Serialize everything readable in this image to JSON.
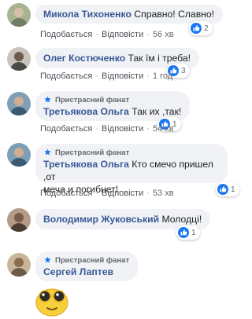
{
  "fan_badge": "Пристрасний фанат",
  "actions": {
    "like": "Подобається",
    "reply": "Відповісти"
  },
  "comments": [
    {
      "author": "Микола Тихоненко",
      "text": "Справно! Славно!",
      "time": "56 хв",
      "reactions": "2"
    },
    {
      "author": "Олег Костюченко",
      "text": "Так їм і треба!",
      "time": "1 год",
      "reactions": "3"
    },
    {
      "author": "Третьякова Ольга",
      "text": "Так их ,так!",
      "time": "54 хв",
      "reactions": "1"
    },
    {
      "author": "Третьякова Ольга",
      "text": "Кто смечо пришел ,от",
      "text2": "меча и погибнет!",
      "time": "53 хв",
      "reactions": "1"
    },
    {
      "author": "Володимир Жуковський",
      "text": "Молодці!",
      "reactions": "1"
    },
    {
      "author": "Сергей Лаптев"
    }
  ],
  "colors": {
    "author": "#385898",
    "like": "#1877f2",
    "bubble": "#f0f2f5"
  }
}
